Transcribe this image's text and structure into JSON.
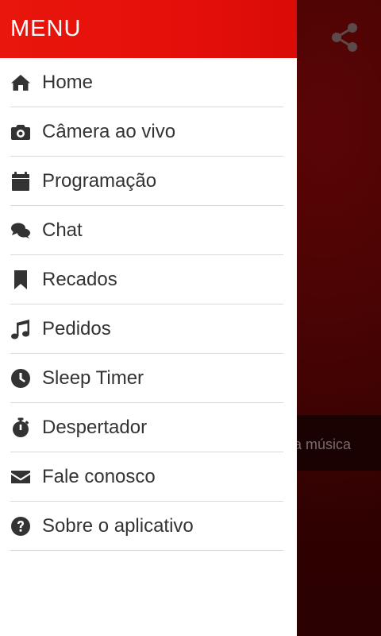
{
  "drawer": {
    "title": "MENU"
  },
  "menu": {
    "items": [
      {
        "label": "Home",
        "icon": "home-icon"
      },
      {
        "label": "Câmera ao vivo",
        "icon": "camera-icon"
      },
      {
        "label": "Programação",
        "icon": "calendar-icon"
      },
      {
        "label": "Chat",
        "icon": "chat-icon"
      },
      {
        "label": "Recados",
        "icon": "bookmark-icon"
      },
      {
        "label": "Pedidos",
        "icon": "music-icon"
      },
      {
        "label": "Sleep Timer",
        "icon": "clock-icon"
      },
      {
        "label": "Despertador",
        "icon": "stopwatch-icon"
      },
      {
        "label": "Fale conosco",
        "icon": "envelope-icon"
      },
      {
        "label": "Sobre o aplicativo",
        "icon": "question-icon"
      }
    ]
  },
  "background": {
    "player_text": "a música"
  },
  "colors": {
    "header": "#e8160c",
    "text": "#333333",
    "divider": "#d9d9d9"
  }
}
